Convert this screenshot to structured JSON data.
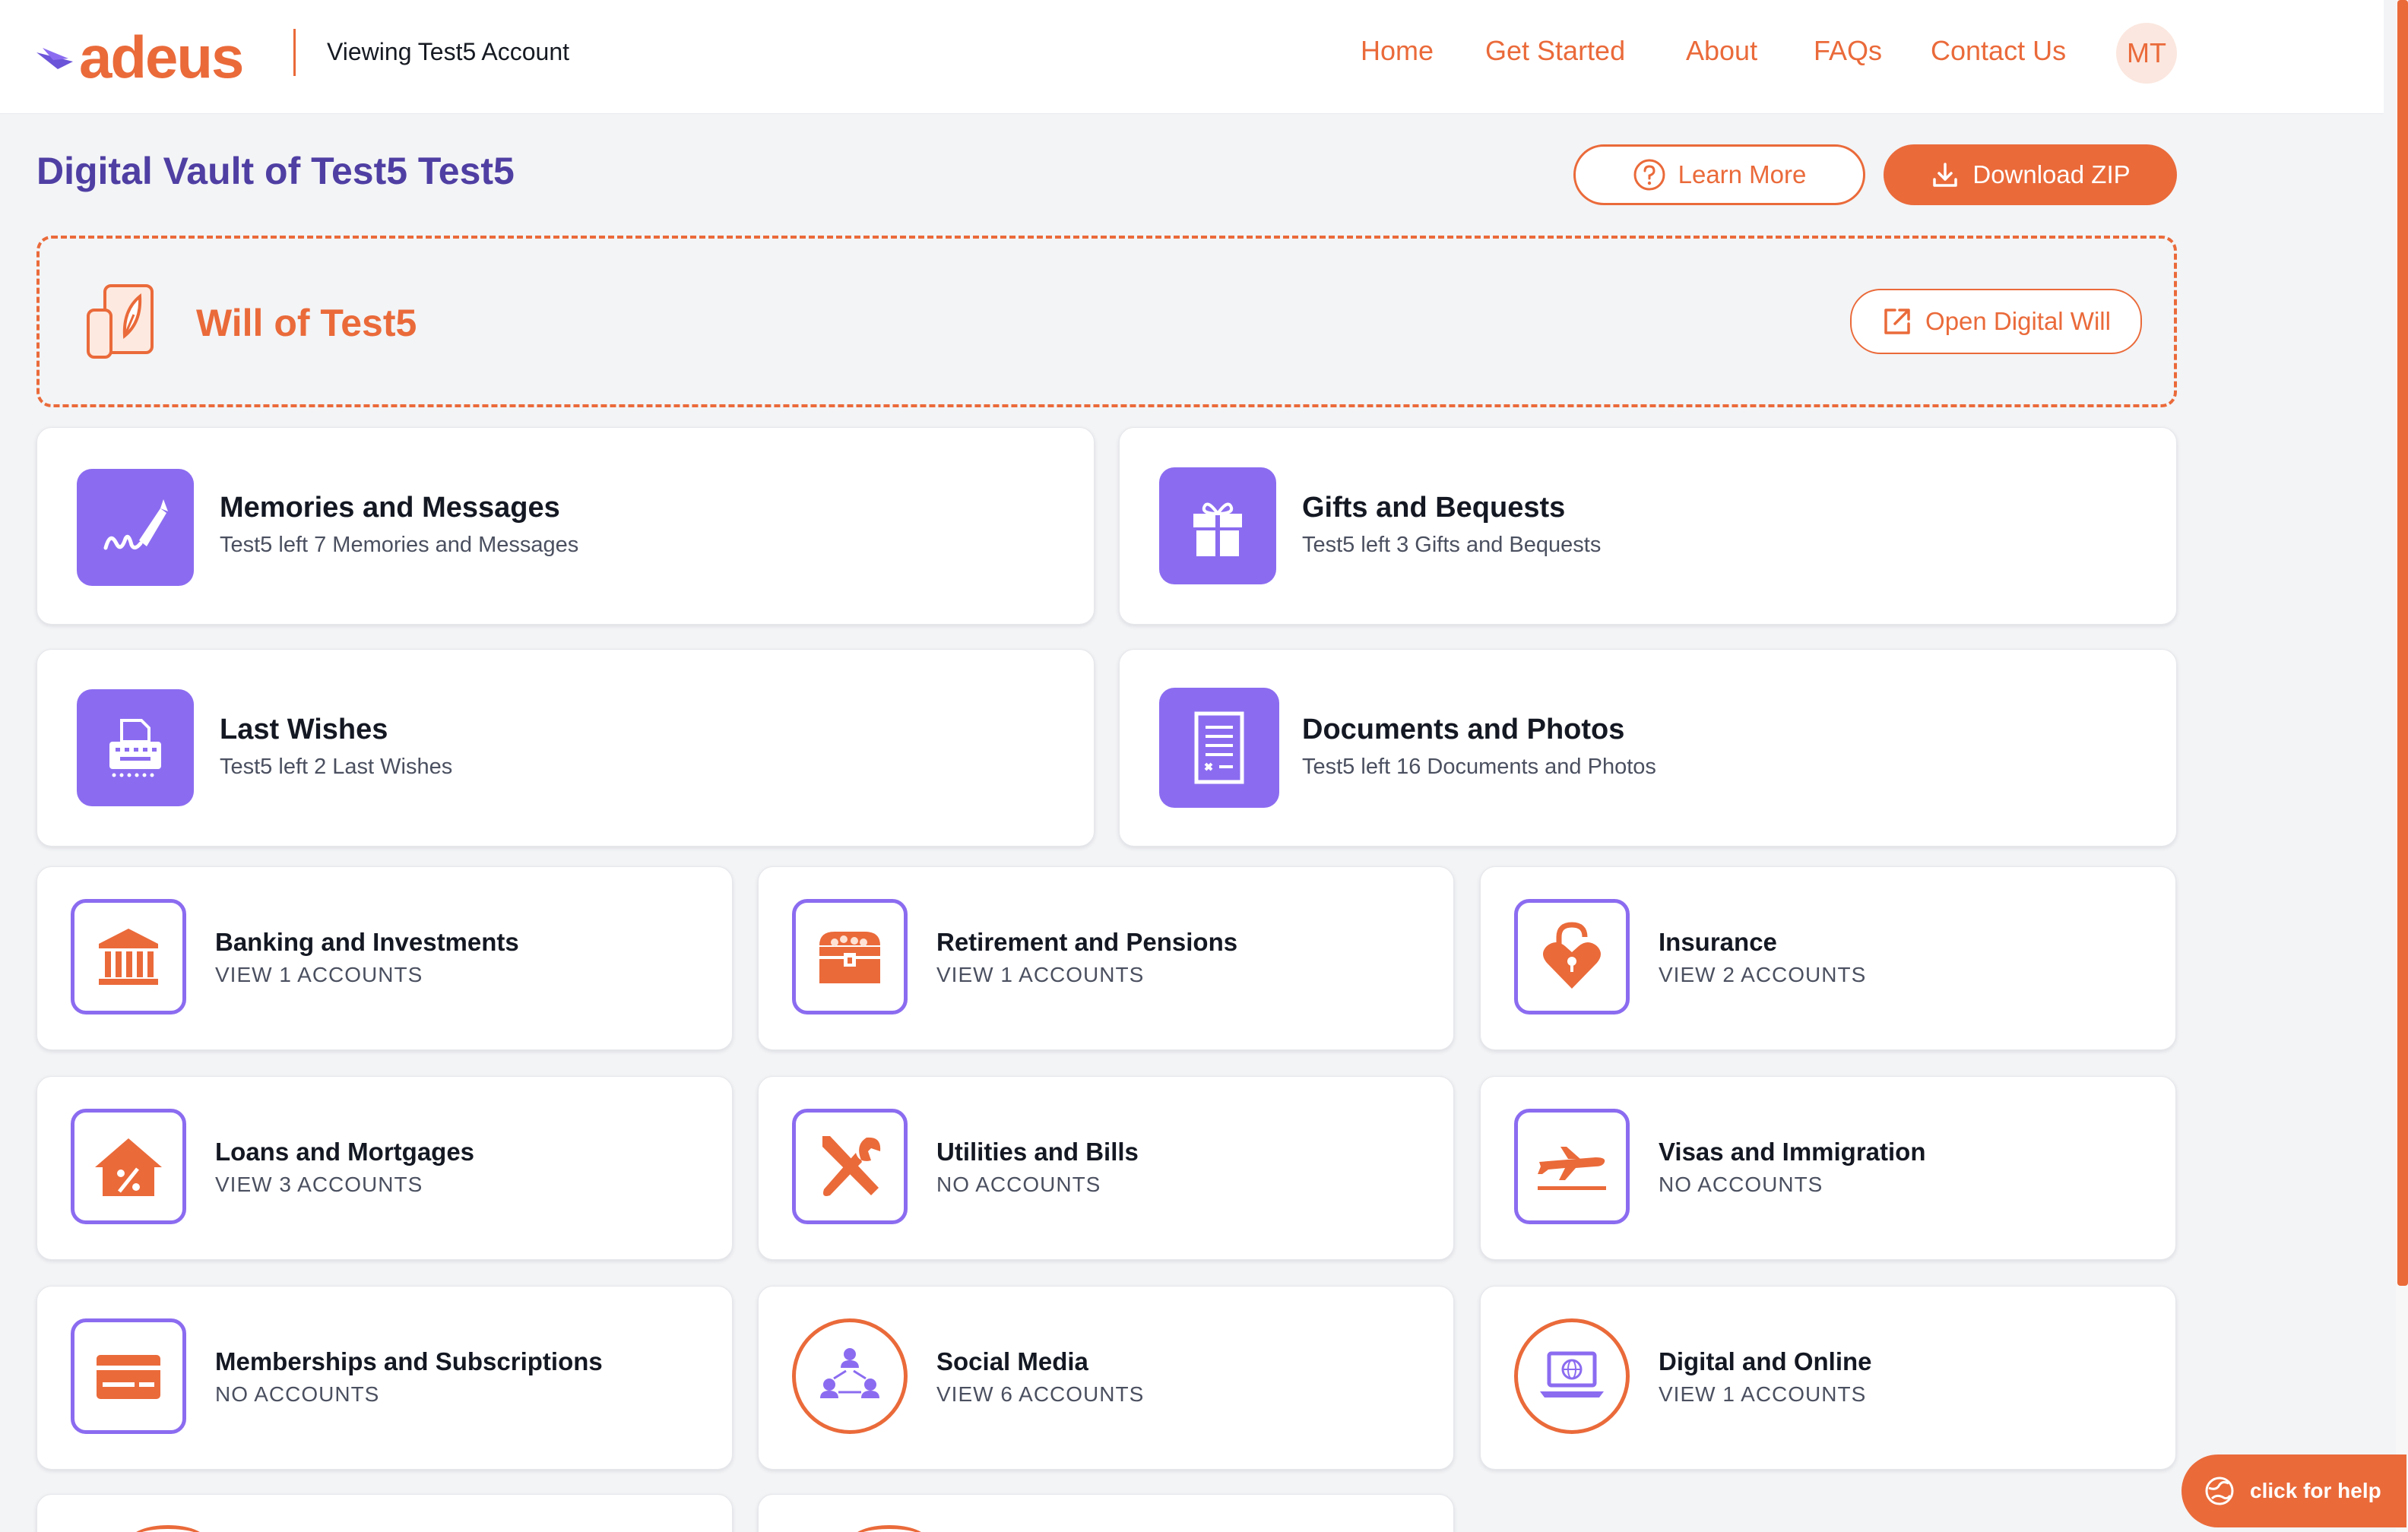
{
  "header": {
    "logo_text": "adeus",
    "viewing": "Viewing Test5 Account",
    "nav": [
      "Home",
      "Get Started",
      "About",
      "FAQs",
      "Contact Us"
    ],
    "avatar_initials": "MT"
  },
  "vault": {
    "title": "Digital Vault of Test5 Test5",
    "learn_more": "Learn More",
    "download_zip": "Download ZIP"
  },
  "will": {
    "title": "Will of Test5",
    "open_button": "Open Digital Will"
  },
  "featured": [
    {
      "title": "Memories and Messages",
      "subtitle": "Test5 left 7 Memories and Messages",
      "icon": "signature-pen-icon"
    },
    {
      "title": "Gifts and Bequests",
      "subtitle": "Test5 left 3 Gifts and Bequests",
      "icon": "gift-icon"
    },
    {
      "title": "Last Wishes",
      "subtitle": "Test5 left 2 Last Wishes",
      "icon": "typewriter-icon"
    },
    {
      "title": "Documents and Photos",
      "subtitle": "Test5 left 16 Documents and Photos",
      "icon": "document-icon"
    }
  ],
  "accounts": [
    {
      "title": "Banking and Investments",
      "subtitle": "VIEW 1 ACCOUNTS",
      "icon": "bank-icon"
    },
    {
      "title": "Retirement and Pensions",
      "subtitle": "VIEW 1 ACCOUNTS",
      "icon": "treasure-chest-icon"
    },
    {
      "title": "Insurance",
      "subtitle": "VIEW 2 ACCOUNTS",
      "icon": "heart-lock-icon"
    },
    {
      "title": "Loans and Mortgages",
      "subtitle": "VIEW 3 ACCOUNTS",
      "icon": "house-percent-icon"
    },
    {
      "title": "Utilities and Bills",
      "subtitle": "NO ACCOUNTS",
      "icon": "tools-icon"
    },
    {
      "title": "Visas and Immigration",
      "subtitle": "NO ACCOUNTS",
      "icon": "airplane-icon"
    },
    {
      "title": "Memberships and Subscriptions",
      "subtitle": "NO ACCOUNTS",
      "icon": "card-icon"
    },
    {
      "title": "Social Media",
      "subtitle": "VIEW 6 ACCOUNTS",
      "icon": "network-people-icon"
    },
    {
      "title": "Digital and Online",
      "subtitle": "VIEW 1 ACCOUNTS",
      "icon": "laptop-globe-icon"
    }
  ],
  "help": {
    "label": "click for help"
  },
  "colors": {
    "accent": "#ea6a3a",
    "purple": "#8b6cf0",
    "title_purple": "#4f3fa3",
    "background": "#f3f4f6"
  }
}
